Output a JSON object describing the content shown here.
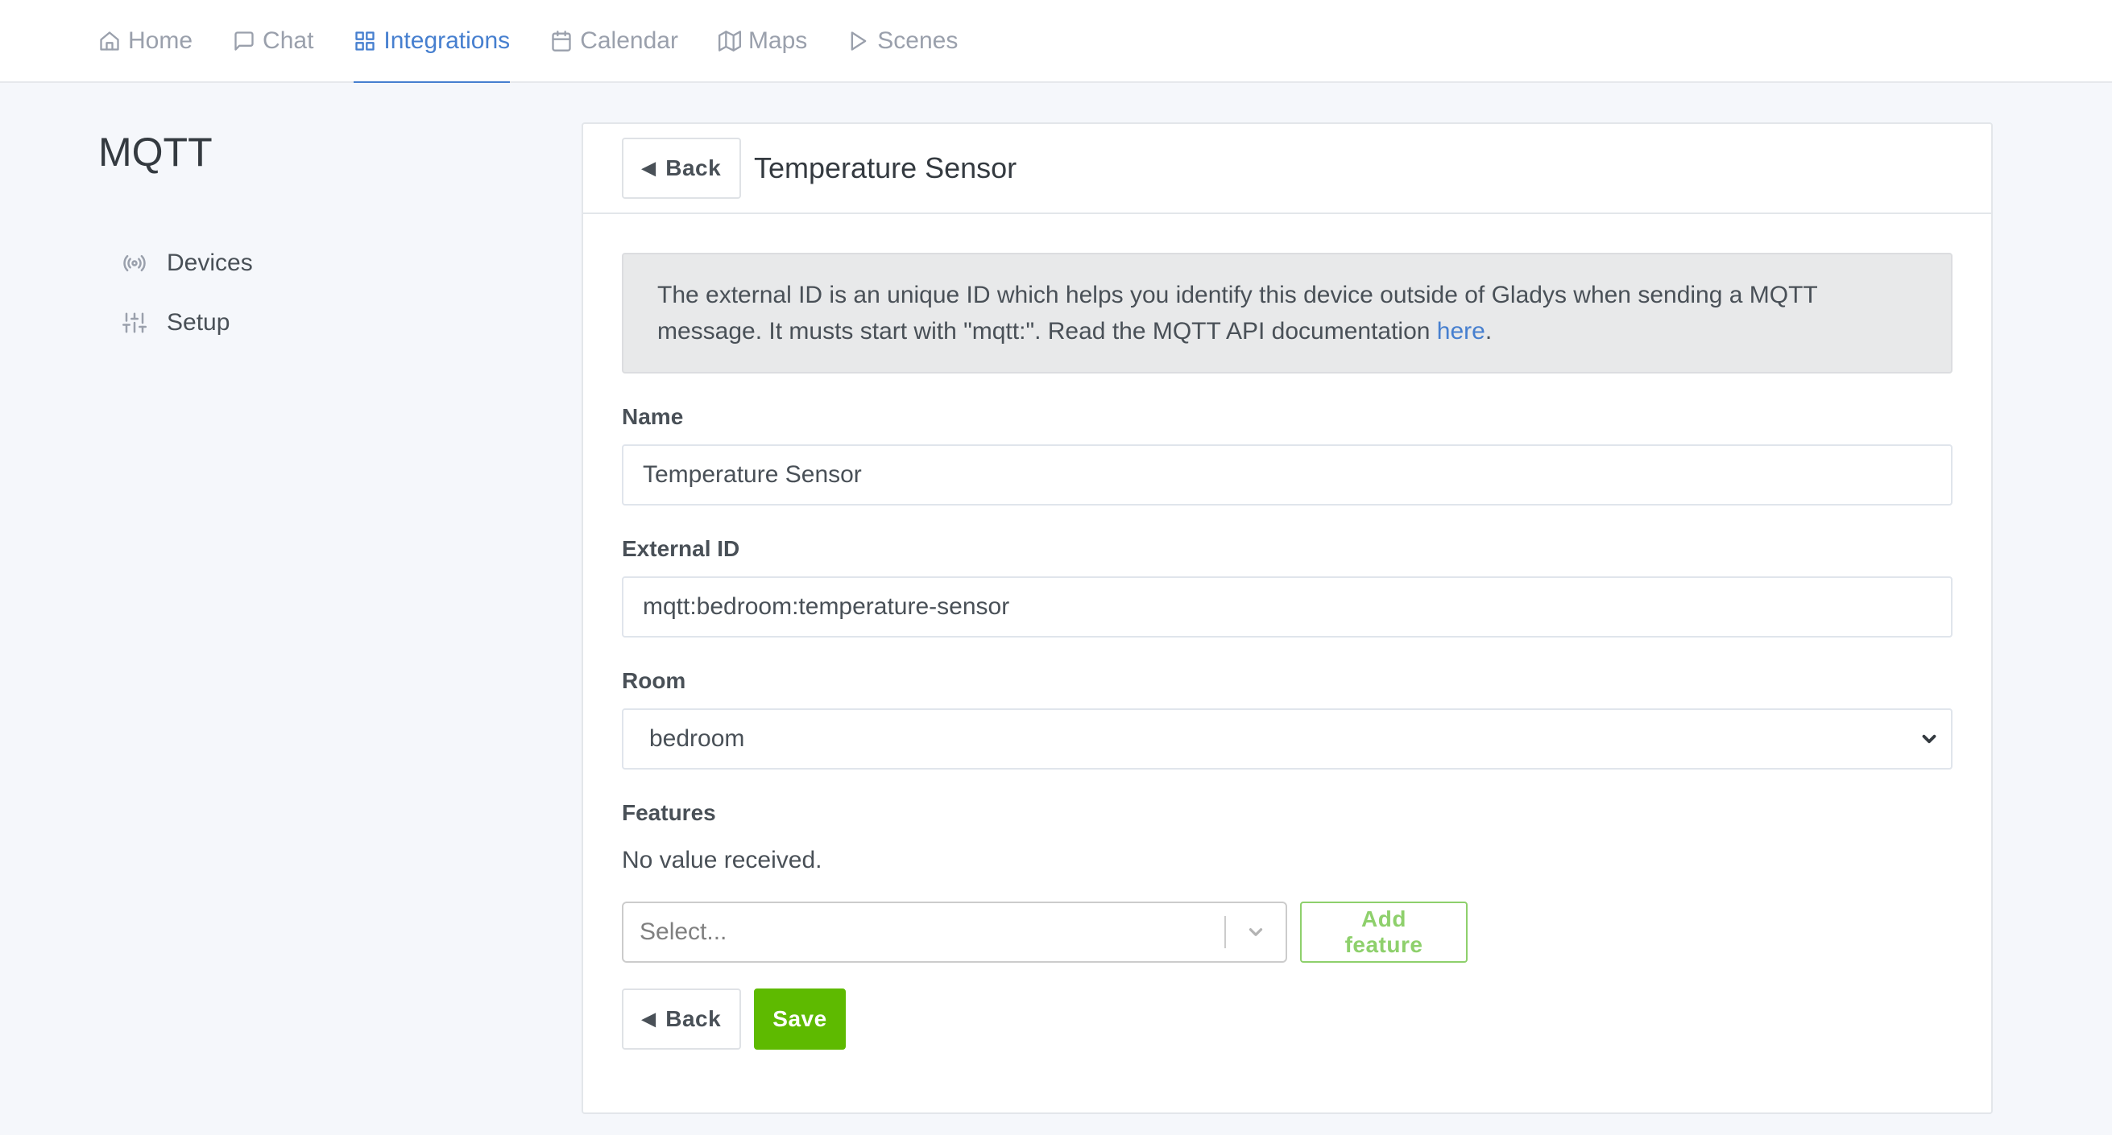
{
  "nav": {
    "items": [
      {
        "label": "Home",
        "icon": "home-icon",
        "active": false
      },
      {
        "label": "Chat",
        "icon": "chat-icon",
        "active": false
      },
      {
        "label": "Integrations",
        "icon": "grid-icon",
        "active": true
      },
      {
        "label": "Calendar",
        "icon": "calendar-icon",
        "active": false
      },
      {
        "label": "Maps",
        "icon": "map-icon",
        "active": false
      },
      {
        "label": "Scenes",
        "icon": "play-icon",
        "active": false
      }
    ]
  },
  "sidebar": {
    "title": "MQTT",
    "items": [
      {
        "label": "Devices",
        "icon": "radio-icon"
      },
      {
        "label": "Setup",
        "icon": "sliders-icon"
      }
    ]
  },
  "card": {
    "back_label": "Back",
    "title": "Temperature Sensor",
    "info_text": "The external ID is an unique ID which helps you identify this device outside of Gladys when sending a MQTT message. It musts start with \"mqtt:\". Read the MQTT API documentation ",
    "info_link": "here",
    "info_end": ".",
    "name_label": "Name",
    "name_value": "Temperature Sensor",
    "external_id_label": "External ID",
    "external_id_value": "mqtt:bedroom:temperature-sensor",
    "room_label": "Room",
    "room_value": "bedroom",
    "features_label": "Features",
    "no_value_text": "No value received.",
    "feature_select_placeholder": "Select...",
    "add_feature_label": "Add feature",
    "footer_back_label": "Back",
    "save_label": "Save"
  },
  "colors": {
    "accent": "#467fcf",
    "success": "#5eba00",
    "success_outline": "#8ed06c",
    "page_bg": "#f5f7fb"
  }
}
